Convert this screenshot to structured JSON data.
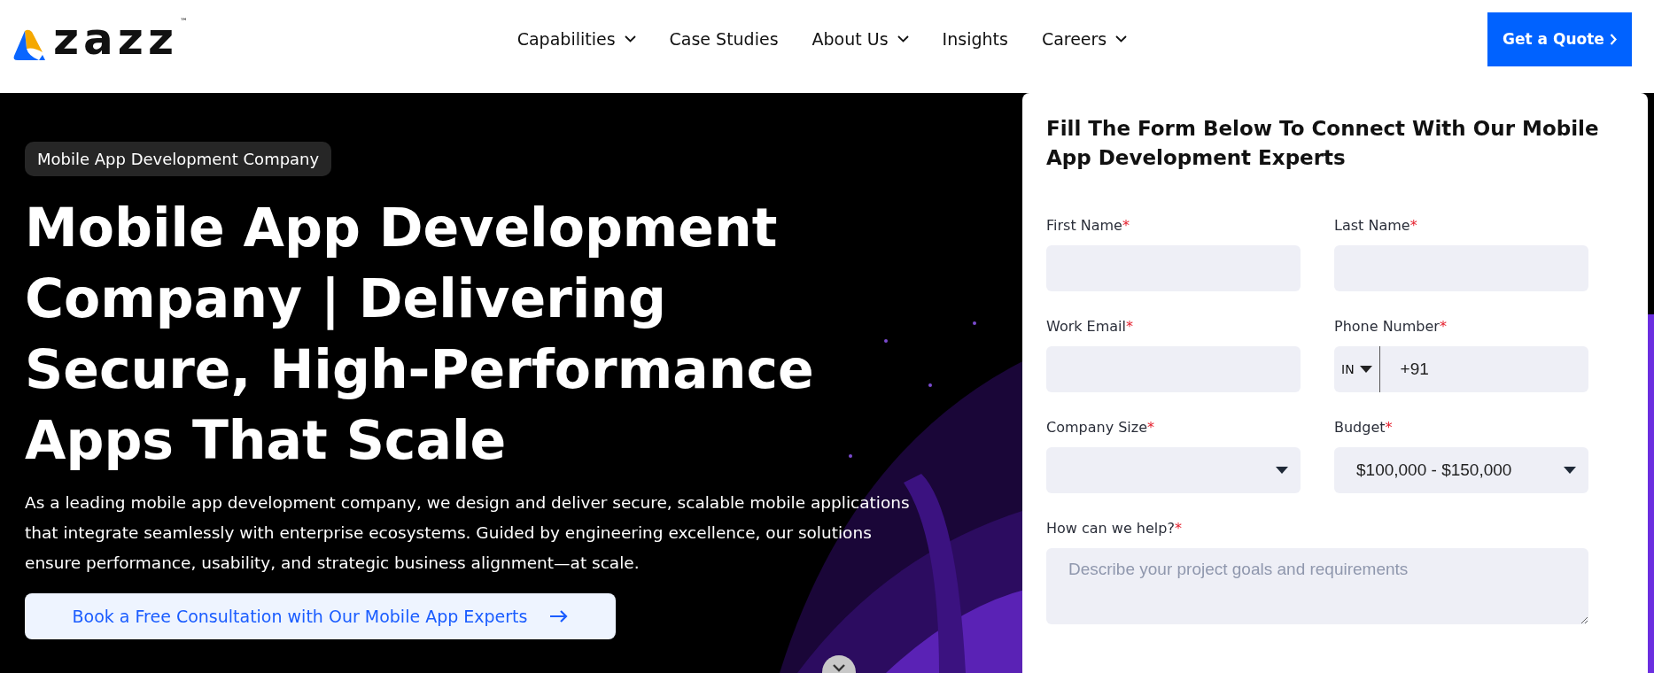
{
  "header": {
    "logo": {
      "text": "zazz",
      "tm": "™"
    },
    "nav": [
      {
        "label": "Capabilities",
        "has_dropdown": true
      },
      {
        "label": "Case Studies",
        "has_dropdown": false
      },
      {
        "label": "About Us",
        "has_dropdown": true
      },
      {
        "label": "Insights",
        "has_dropdown": false
      },
      {
        "label": "Careers",
        "has_dropdown": true
      }
    ],
    "cta": "Get a Quote"
  },
  "hero": {
    "badge": "Mobile App Development Company",
    "title": "Mobile App Development Company | Delivering Secure, High-Performance Apps That Scale",
    "description": "As a leading mobile app development company, we design and deliver secure, scalable mobile applications that integrate seamlessly with enterprise ecosystems. Guided by engineering excellence, our solutions ensure performance, usability, and strategic business alignment—at scale.",
    "button": "Book a Free Consultation with Our Mobile App Experts"
  },
  "form": {
    "title": "Fill The Form Below To Connect With Our Mobile App Development Experts",
    "fields": [
      {
        "kind": "text",
        "label": "First Name",
        "mark": "*"
      },
      {
        "kind": "text",
        "label": "Last Name",
        "mark": "*"
      },
      {
        "kind": "text",
        "label": "Work Email",
        "mark": "*"
      },
      {
        "kind": "phone",
        "label": "Phone Number",
        "mark": "*",
        "country": "IN",
        "value": "+91"
      },
      {
        "kind": "select",
        "label": "Company Size",
        "mark": "*"
      },
      {
        "kind": "select",
        "label": "Budget",
        "mark": "*",
        "value": "$100,000 - $150,000"
      },
      {
        "kind": "textarea",
        "label": "How can we help?",
        "mark": "*",
        "placeholder": "Describe your project goals and requirements"
      }
    ]
  }
}
